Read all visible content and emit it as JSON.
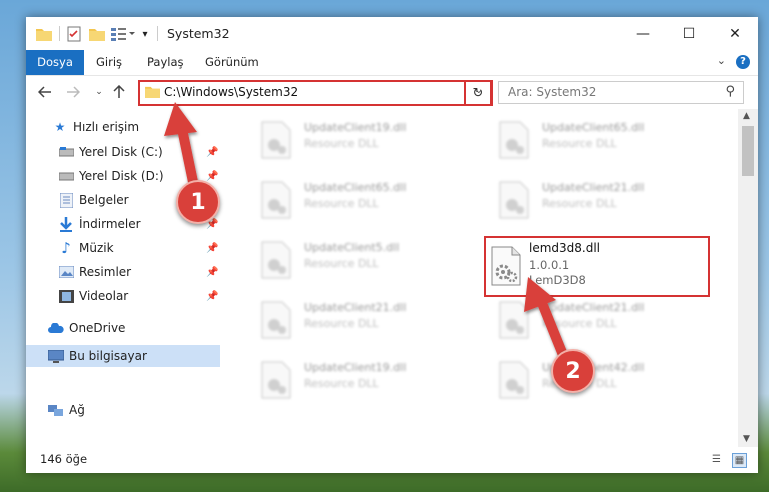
{
  "window": {
    "title": "System32",
    "controls": {
      "minimize": "—",
      "maximize": "☐",
      "close": "✕"
    }
  },
  "ribbon": {
    "tabs": [
      "Dosya",
      "Giriş",
      "Paylaş",
      "Görünüm"
    ],
    "help": "?"
  },
  "navigation": {
    "address": "C:\\Windows\\System32",
    "search_placeholder": "Ara: System32"
  },
  "sidebar": {
    "quick_access": "Hızlı erişim",
    "items": [
      {
        "label": "Yerel Disk (C:)",
        "icon": "drive-icon"
      },
      {
        "label": "Yerel Disk (D:)",
        "icon": "drive-icon"
      },
      {
        "label": "Belgeler",
        "icon": "documents-icon"
      },
      {
        "label": "İndirmeler",
        "icon": "download-icon"
      },
      {
        "label": "Müzik",
        "icon": "music-icon"
      },
      {
        "label": "Resimler",
        "icon": "pictures-icon"
      },
      {
        "label": "Videolar",
        "icon": "videos-icon"
      }
    ],
    "onedrive": "OneDrive",
    "this_pc": "Bu bilgisayar",
    "network": "Ağ"
  },
  "files_blurred": [
    {
      "name": "UpdateClient19.dll",
      "desc": "Resource DLL"
    },
    {
      "name": "UpdateClient65.dll",
      "desc": "Resource DLL"
    },
    {
      "name": "UpdateClient65.dll",
      "desc": "Resource DLL"
    },
    {
      "name": "UpdateClient21.dll",
      "desc": "Resource DLL"
    },
    {
      "name": "UpdateClient5.dll",
      "desc": "Resource DLL"
    },
    {
      "name": "UpdateClient21.dll",
      "desc": "Resource DLL"
    },
    {
      "name": "UpdateClient21.dll",
      "desc": "Resource DLL"
    },
    {
      "name": "UpdateClient19.dll",
      "desc": "Resource DLL"
    },
    {
      "name": "UpdateClient42.dll",
      "desc": "Resource DLL"
    }
  ],
  "highlighted_file": {
    "name": "lemd3d8.dll",
    "version": "1.0.0.1",
    "company": "LemD3D8"
  },
  "status": {
    "count": "146 öğe"
  },
  "annotations": {
    "step1": "1",
    "step2": "2",
    "color": "#d9403a"
  }
}
